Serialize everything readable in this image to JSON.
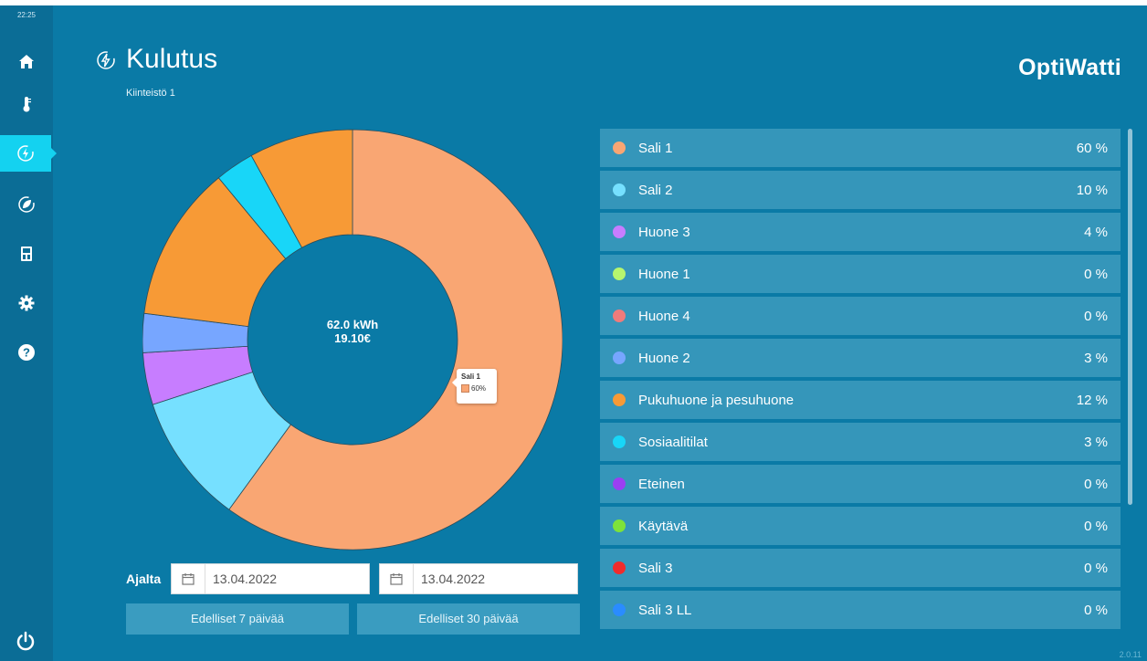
{
  "status": {
    "clock": "22:25"
  },
  "sidebar": {
    "items": [
      {
        "icon": "home-icon"
      },
      {
        "icon": "thermometer-icon"
      },
      {
        "icon": "energy-icon",
        "active": true
      },
      {
        "icon": "eco-icon"
      },
      {
        "icon": "meter-icon"
      },
      {
        "icon": "gear-icon"
      },
      {
        "icon": "help-icon"
      }
    ],
    "power_icon": "power-icon"
  },
  "header": {
    "title": "Kulutus",
    "subtitle": "Kiinteistö 1",
    "logo": "OptiWatti"
  },
  "chart_data": {
    "type": "pie",
    "donut": true,
    "center": {
      "energy": "62.0 kWh",
      "cost": "19.10€"
    },
    "tooltip": {
      "label": "Sali 1",
      "value": "60%"
    },
    "slices": [
      {
        "name": "Sali 1",
        "value": 60,
        "color": "#f9a673"
      },
      {
        "name": "Sali 2",
        "value": 10,
        "color": "#76e0ff"
      },
      {
        "name": "Huone 3",
        "value": 4,
        "color": "#c77dff"
      },
      {
        "name": "Huone 2",
        "value": 3,
        "color": "#77a6ff"
      },
      {
        "name": "Pukuhuone ja pesuhuone",
        "value": 12,
        "color": "#f79a36"
      },
      {
        "name": "Sosiaalitilat",
        "value": 3,
        "color": "#18d6f8"
      },
      {
        "name": "Pukuhuone ja pesuhuone",
        "value": 8,
        "color": "#f79a36"
      }
    ]
  },
  "date_range": {
    "label": "Ajalta",
    "from": "13.04.2022",
    "to": "13.04.2022",
    "preset_7": "Edelliset 7 päivää",
    "preset_30": "Edelliset 30 päivää"
  },
  "legend": [
    {
      "name": "Sali 1",
      "pct": "60 %",
      "color": "#f9a673"
    },
    {
      "name": "Sali 2",
      "pct": "10 %",
      "color": "#76e0ff"
    },
    {
      "name": "Huone 3",
      "pct": "4 %",
      "color": "#c77dff"
    },
    {
      "name": "Huone 1",
      "pct": "0 %",
      "color": "#b6f56e"
    },
    {
      "name": "Huone 4",
      "pct": "0 %",
      "color": "#f07b7b"
    },
    {
      "name": "Huone 2",
      "pct": "3 %",
      "color": "#77a6ff"
    },
    {
      "name": "Pukuhuone ja pesuhuone",
      "pct": "12 %",
      "color": "#f79a36"
    },
    {
      "name": "Sosiaalitilat",
      "pct": "3 %",
      "color": "#18d6f8"
    },
    {
      "name": "Eteinen",
      "pct": "0 %",
      "color": "#9b3ff2"
    },
    {
      "name": "Käytävä",
      "pct": "0 %",
      "color": "#7ee23a"
    },
    {
      "name": "Sali 3",
      "pct": "0 %",
      "color": "#f02b2b"
    },
    {
      "name": "Sali 3 LL",
      "pct": "0 %",
      "color": "#2a8cff"
    }
  ],
  "footer": {
    "version": "2.0.11"
  }
}
